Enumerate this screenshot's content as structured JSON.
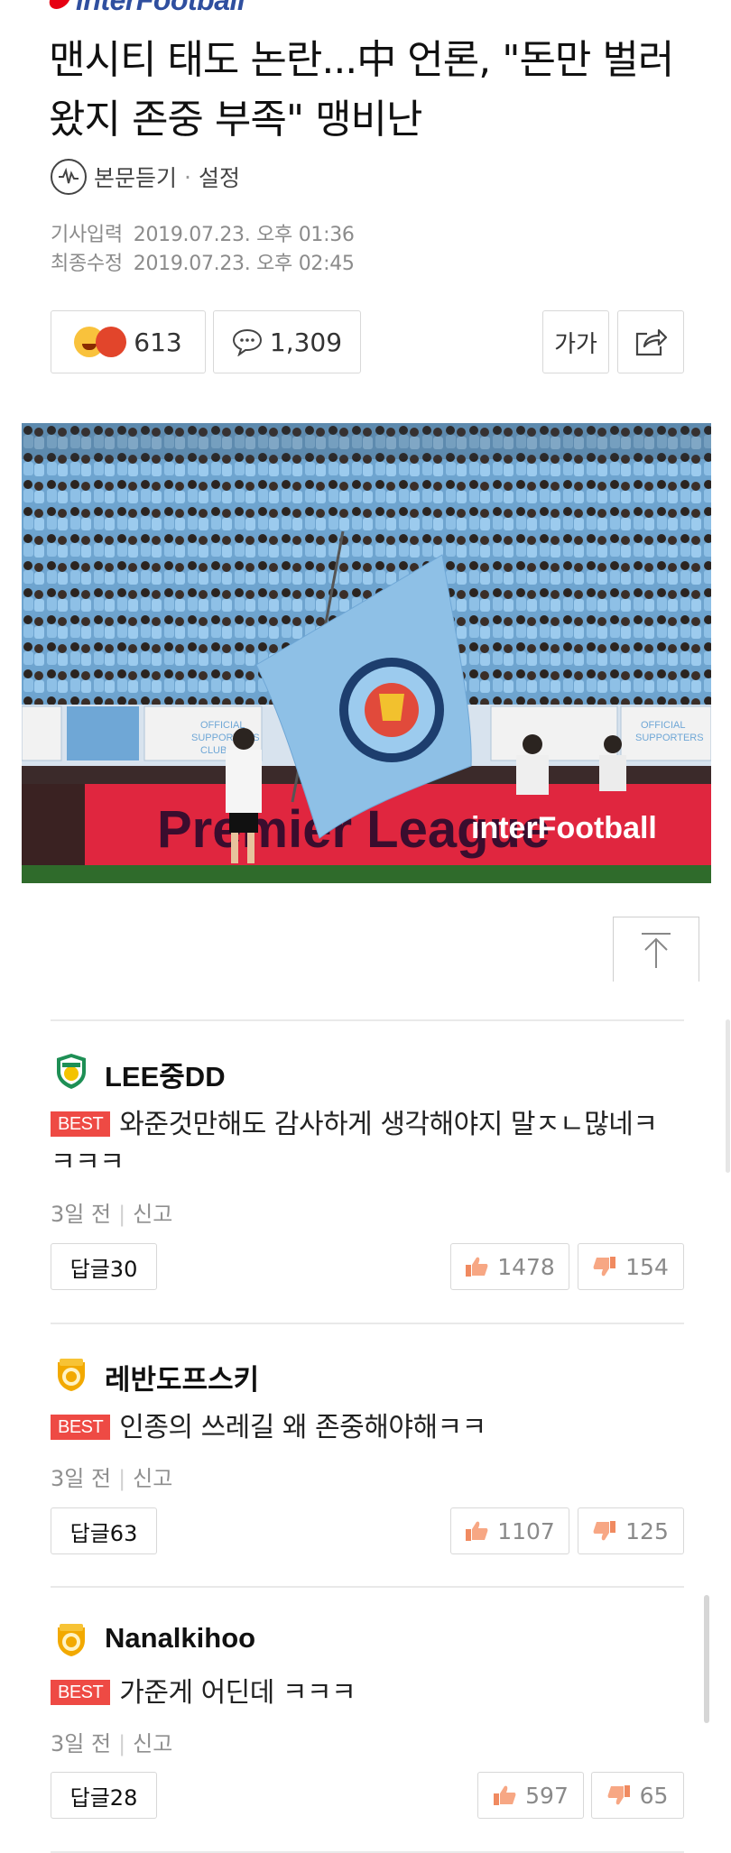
{
  "header": {
    "logo_text": "interFootball"
  },
  "article": {
    "title": "맨시티 태도 논란...中 언론, \"돈만 벌러 왔지 존중 부족\" 맹비난",
    "listen_label": "본문듣기",
    "settings_label": "설정",
    "published_label": "기사입력",
    "published_value": "2019.07.23. 오후 01:36",
    "modified_label": "최종수정",
    "modified_value": "2019.07.23. 오후 02:45",
    "reaction_count": "613",
    "comment_count": "1,309",
    "font_size_label": "가가",
    "photo_watermark": "interFootball",
    "photo_banner": "Premier League"
  },
  "comments": [
    {
      "user": "LEE중DD",
      "best": "BEST",
      "text": "와준것만해도 감사하게 생각해야지 말ㅈㄴ많네ㅋㅋㅋㅋ",
      "time": "3일 전",
      "report": "신고",
      "replies": "답글30",
      "likes": "1478",
      "dislikes": "154",
      "badge": "green-shield"
    },
    {
      "user": "레반도프스키",
      "best": "BEST",
      "text": "인종의 쓰레길 왜 존중해야해ㅋㅋ",
      "time": "3일 전",
      "report": "신고",
      "replies": "답글63",
      "likes": "1107",
      "dislikes": "125",
      "badge": "gold-shield"
    },
    {
      "user": "Nanalkihoo",
      "best": "BEST",
      "text": "가준게 어딘데 ㅋㅋㅋ",
      "time": "3일 전",
      "report": "신고",
      "replies": "답글28",
      "likes": "597",
      "dislikes": "65",
      "badge": "gold-shield"
    }
  ],
  "colors": {
    "best_badge": "#ee4a44",
    "logo_blue": "#2f4f9f",
    "logo_red": "#e60012",
    "city_blue": "#8ec0e6"
  }
}
